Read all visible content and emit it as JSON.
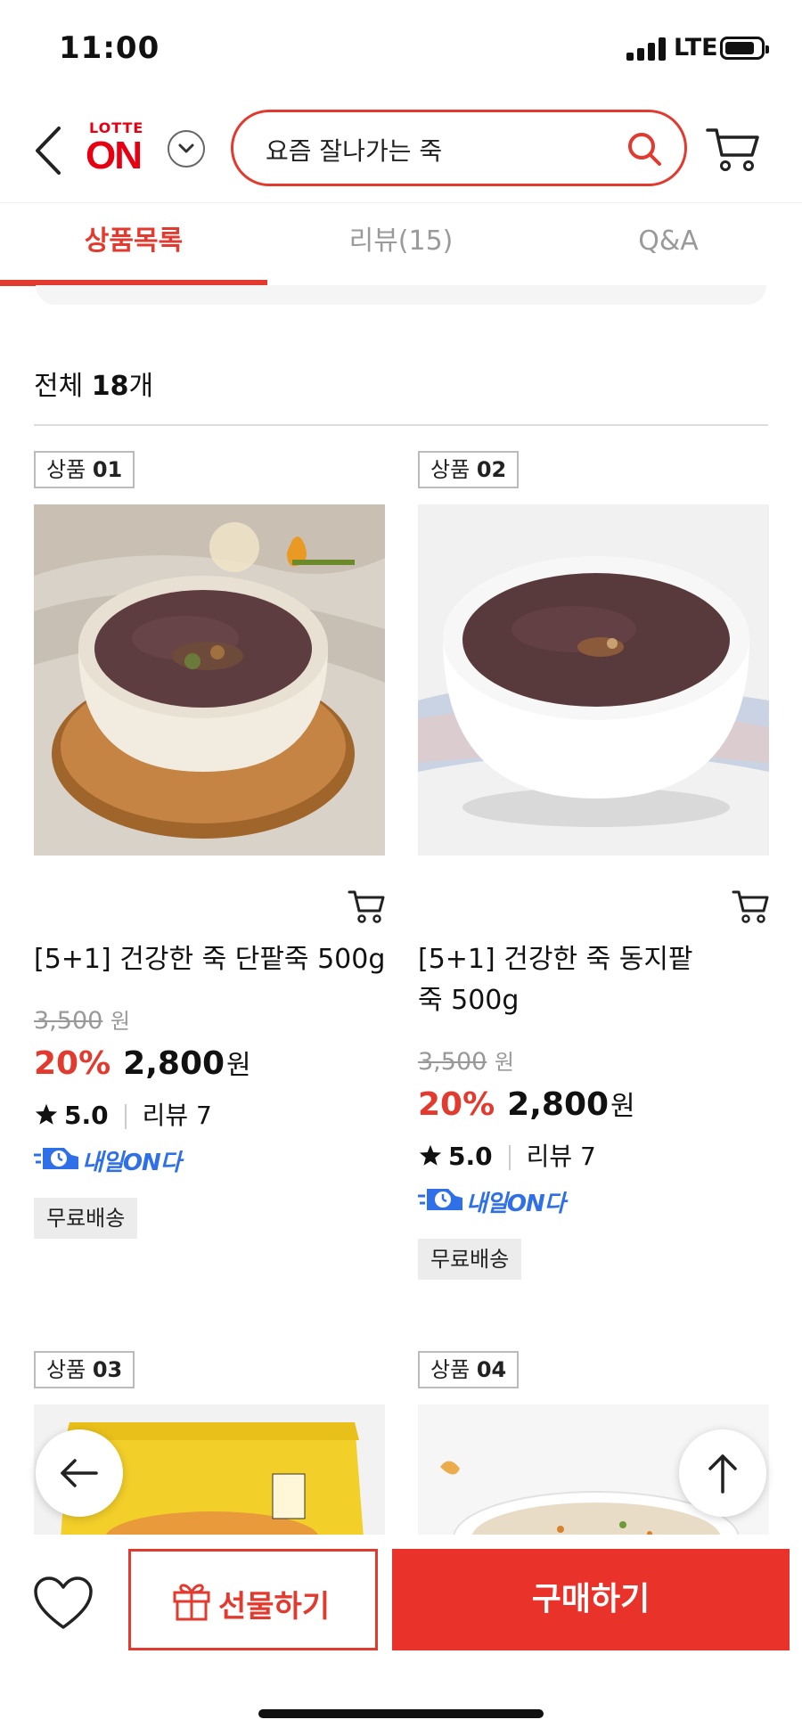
{
  "status_bar": {
    "time": "11:00",
    "network": "LTE"
  },
  "header": {
    "logo_top": "LOTTE",
    "logo_main": "ON",
    "search_text": "요즘 잘나가는 죽"
  },
  "tabs": [
    {
      "label": "상품목록",
      "active": true
    },
    {
      "label": "리뷰(15)",
      "active": false
    },
    {
      "label": "Q&A",
      "active": false
    }
  ],
  "summary": {
    "prefix": "전체",
    "count": "18",
    "suffix": "개"
  },
  "products": [
    {
      "badge_label": "상품",
      "badge_num": "01",
      "title": "[5+1] 건강한 죽 단팥죽 500g",
      "original_price": "3,500",
      "original_unit": "원",
      "discount": "20%",
      "sale_price": "2,800",
      "sale_unit": "원",
      "rating": "5.0",
      "review": "리뷰 7",
      "delivery": "내일ON다",
      "shipping": "무료배송"
    },
    {
      "badge_label": "상품",
      "badge_num": "02",
      "title": "[5+1] 건강한 죽 동지팥죽 500g",
      "original_price": "3,500",
      "original_unit": "원",
      "discount": "20%",
      "sale_price": "2,800",
      "sale_unit": "원",
      "rating": "5.0",
      "review": "리뷰 7",
      "delivery": "내일ON다",
      "shipping": "무료배송"
    },
    {
      "badge_label": "상품",
      "badge_num": "03"
    },
    {
      "badge_label": "상품",
      "badge_num": "04"
    }
  ],
  "bottom_bar": {
    "gift_label": "선물하기",
    "buy_label": "구매하기"
  },
  "colors": {
    "accent": "#e23a2e",
    "buy": "#e8322a",
    "delivery": "#2f6fe8"
  }
}
